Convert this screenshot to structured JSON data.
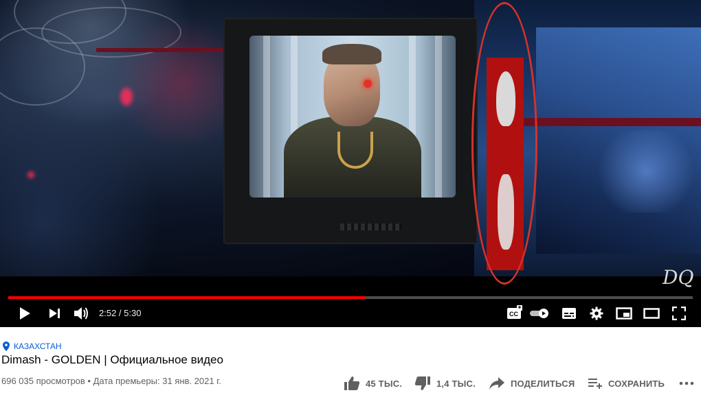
{
  "player": {
    "time_current": "2:52",
    "time_separator": " / ",
    "time_total": "5:30",
    "progress_played_fraction": 0.521,
    "progress_buffered_fraction": 0.521,
    "watermark": "DQ",
    "autoplay_toggle": "on",
    "accent_color": "#ff0000",
    "annotation_color": "#d6322a"
  },
  "video": {
    "location": "КАЗАХСТАН",
    "title": "Dimash - GOLDEN | Официальное видео",
    "views": "696 035 просмотров",
    "dot": " • ",
    "premiere": "Дата премьеры: 31 янв. 2021 г."
  },
  "actions": {
    "like": "45 ТЫС.",
    "dislike": "1,4 ТЫС.",
    "share": "ПОДЕЛИТЬСЯ",
    "save": "СОХРАНИТЬ"
  },
  "colors": {
    "link": "#065fd4",
    "text_primary": "#030303",
    "text_secondary": "#606060"
  }
}
